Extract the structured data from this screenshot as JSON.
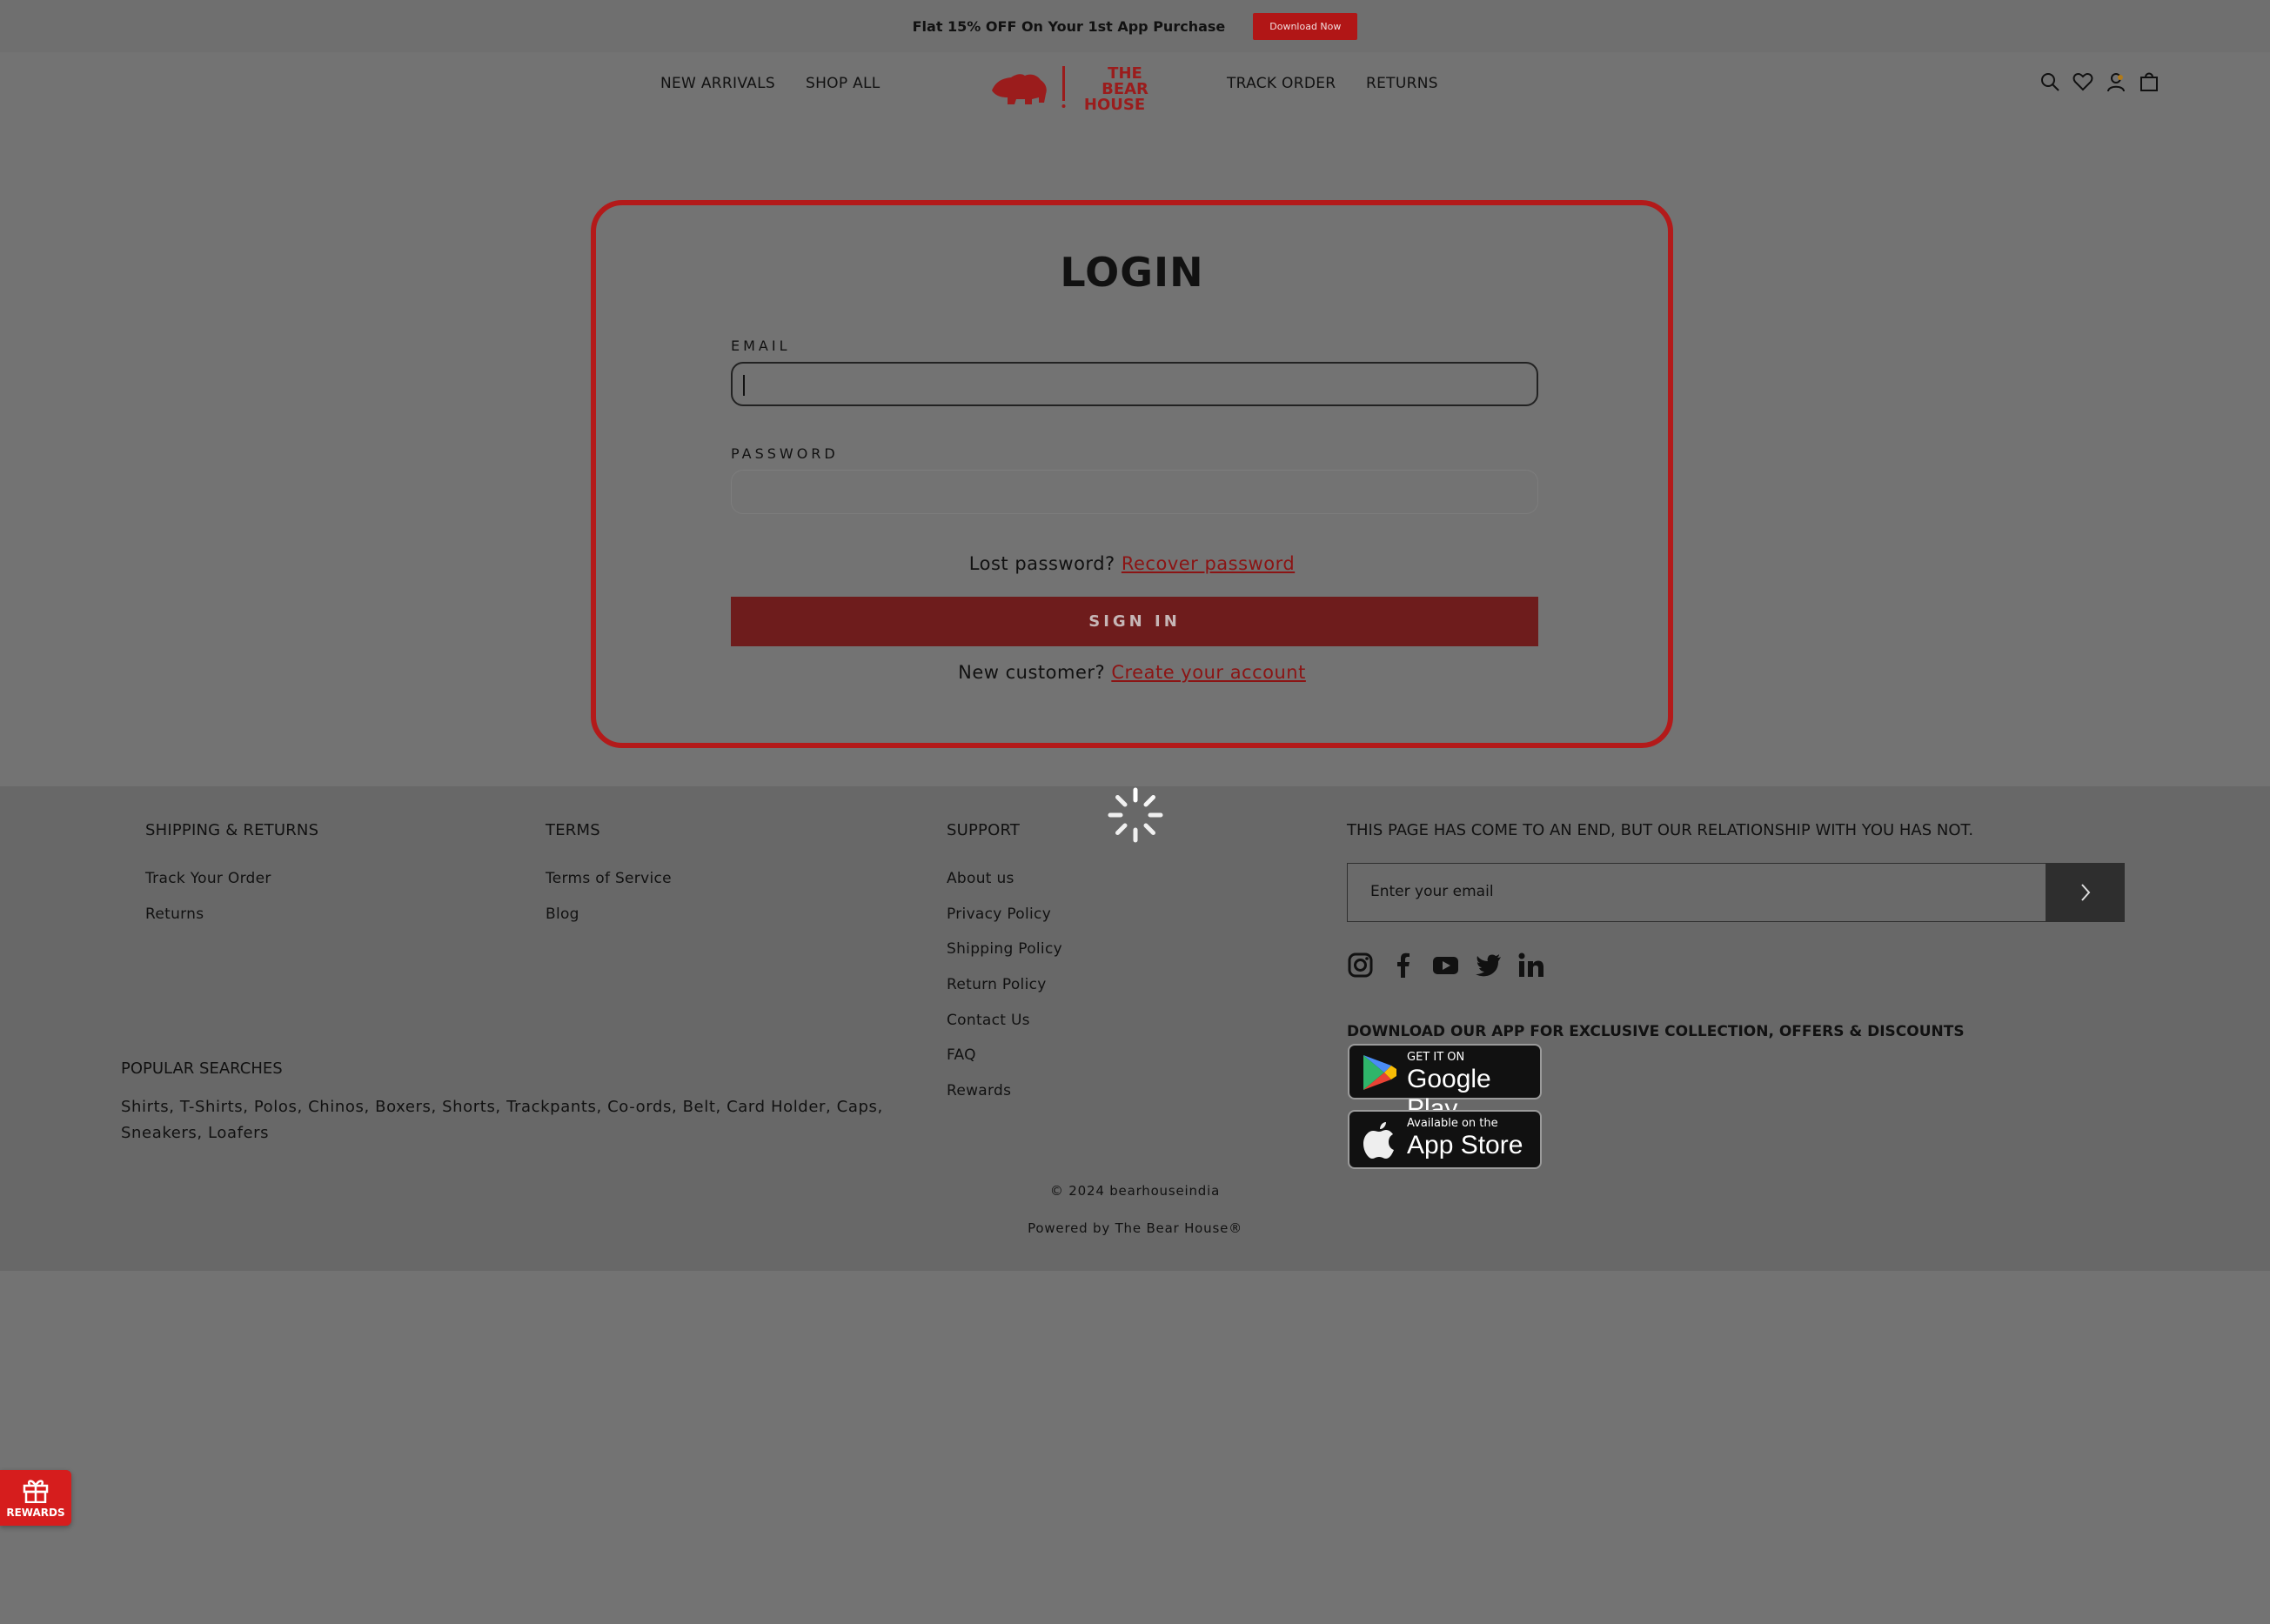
{
  "topbar": {
    "promo_text": "Flat 15% OFF On Your 1st App Purchase",
    "download_label": "Download Now"
  },
  "header": {
    "nav_left": [
      "NEW ARRIVALS",
      "SHOP ALL"
    ],
    "nav_right": [
      "TRACK ORDER",
      "RETURNS"
    ],
    "logo_lines": [
      "THE",
      "BEAR",
      "HOUSE"
    ],
    "icons": [
      "search-icon",
      "heart-icon",
      "account-icon",
      "bag-icon"
    ]
  },
  "login": {
    "title": "LOGIN",
    "email_label": "EMAIL",
    "password_label": "PASSWORD",
    "lost_password_text": "Lost password?",
    "recover_link": "Recover password",
    "signin_label": "SIGN IN",
    "new_customer_text": "New customer?",
    "create_link": "Create your account"
  },
  "footer": {
    "columns": [
      {
        "title": "SHIPPING & RETURNS",
        "links": [
          "Track Your Order",
          "Returns"
        ]
      },
      {
        "title": "TERMS",
        "links": [
          "Terms of Service",
          "Blog"
        ]
      },
      {
        "title": "SUPPORT",
        "links": [
          "About us",
          "Privacy Policy",
          "Shipping Policy",
          "Return Policy",
          "Contact Us",
          "FAQ",
          "Rewards"
        ]
      }
    ],
    "newsletter_heading": "THIS PAGE HAS COME TO AN END, BUT OUR RELATIONSHIP WITH YOU HAS NOT.",
    "newsletter_placeholder": "Enter your email",
    "socials": [
      "instagram-icon",
      "facebook-icon",
      "youtube-icon",
      "twitter-icon",
      "linkedin-icon"
    ],
    "app_heading": "DOWNLOAD OUR APP FOR EXCLUSIVE COLLECTION, OFFERS & DISCOUNTS",
    "google_play": {
      "small": "GET IT ON",
      "big": "Google Play"
    },
    "app_store": {
      "small": "Available on the",
      "big": "App Store"
    },
    "popular_heading": "POPULAR SEARCHES",
    "popular_text": "Shirts, T-Shirts, Polos, Chinos, Boxers, Shorts, Trackpants, Co-ords, Belt, Card Holder, Caps, Sneakers, Loafers",
    "copyright": "© 2024 bearhouseindia",
    "powered_by": "Powered by The Bear House®"
  },
  "rewards_widget": {
    "label": "REWARDS"
  },
  "colors": {
    "brand_red": "#b31a1a",
    "overlay_gray": "#737373"
  }
}
